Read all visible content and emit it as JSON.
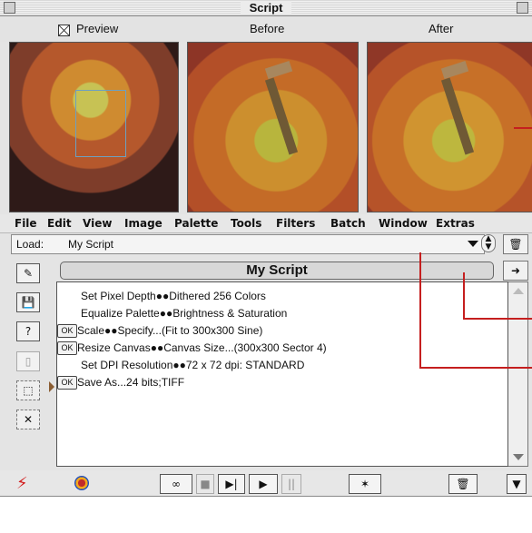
{
  "window": {
    "title": "Script"
  },
  "preview": {
    "checkbox_label": "Preview",
    "before_label": "Before",
    "after_label": "After"
  },
  "menubar": {
    "items": [
      "File",
      "Edit",
      "View",
      "Image",
      "Palette",
      "Tools",
      "Filters",
      "Batch",
      "Window",
      "Extras"
    ]
  },
  "load": {
    "label": "Load:",
    "value": "My Script"
  },
  "script": {
    "title": "My Script",
    "steps": [
      {
        "text": "Set Pixel Depth●●Dithered 256 Colors",
        "ok": false
      },
      {
        "text": "Equalize Palette●●Brightness & Saturation",
        "ok": false
      },
      {
        "text": "Scale●●Specify...(Fit to 300x300 Sine)",
        "ok": true
      },
      {
        "text": "Resize Canvas●●Canvas Size...(300x300 Sector 4)",
        "ok": true
      },
      {
        "text": "Set DPI Resolution●●72 x 72 dpi: STANDARD",
        "ok": false
      },
      {
        "text": "Save As...24 bits;TIFF",
        "ok": true
      }
    ]
  },
  "labels": {
    "ok_badge": "OK"
  },
  "colors": {
    "callout": "#c51f1f"
  }
}
